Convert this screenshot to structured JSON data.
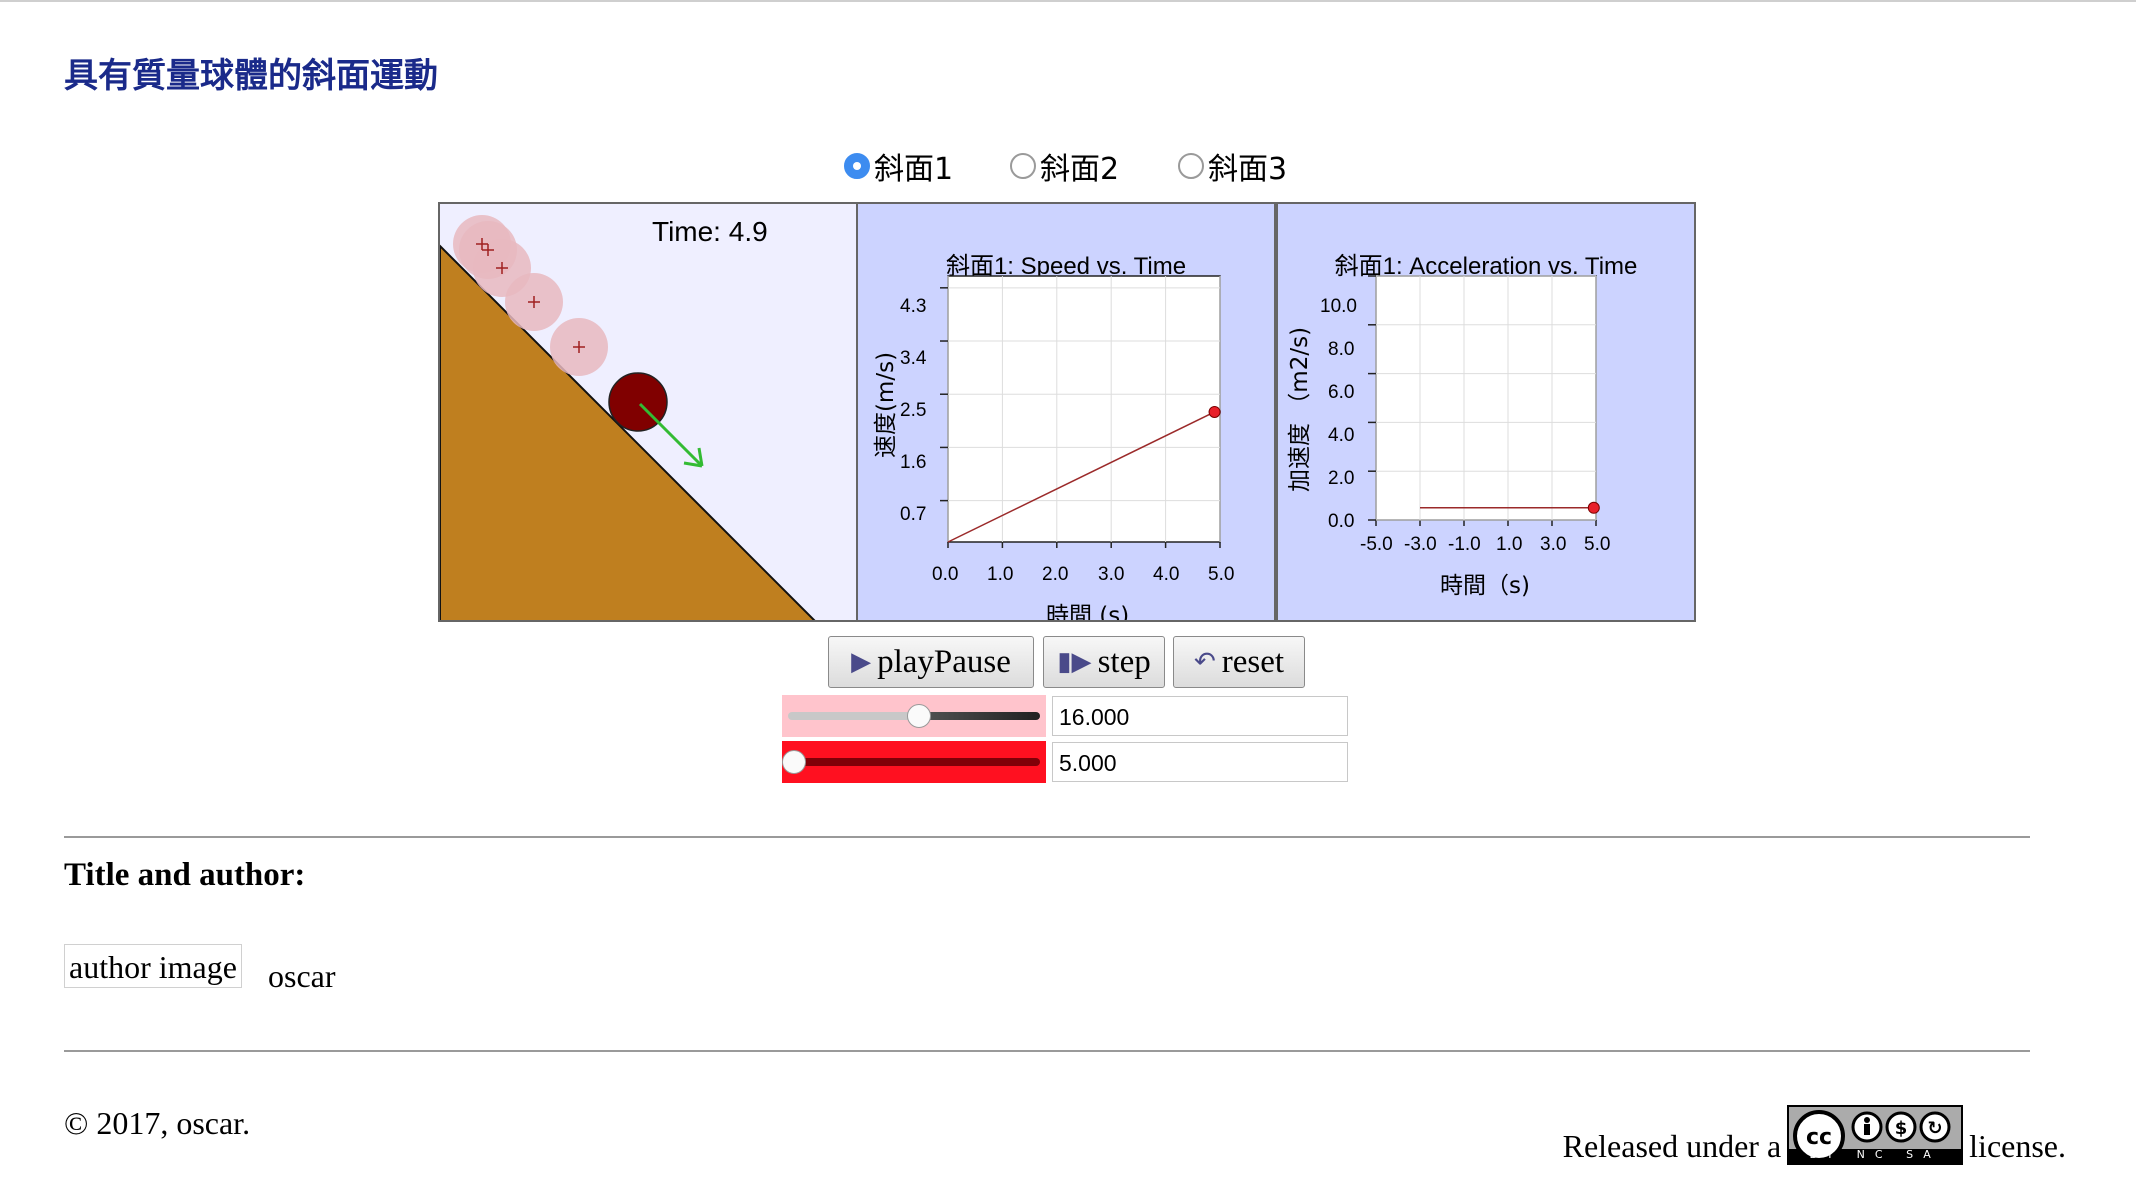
{
  "page": {
    "title": "具有質量球體的斜面運動"
  },
  "radios": [
    {
      "label": "斜面1",
      "checked": true
    },
    {
      "label": "斜面2",
      "checked": false
    },
    {
      "label": "斜面3",
      "checked": false
    }
  ],
  "simulation": {
    "time_label": "Time: 4.9",
    "ground_color": "#bf7f1f",
    "ball_color": "#800000",
    "arrow_color": "#33bb33"
  },
  "charts": {
    "speed": {
      "title": "斜面1: Speed vs. Time",
      "ylabel": "速度(m/s)",
      "xlabel": "時間 (s)",
      "yticks": [
        "4.3",
        "3.4",
        "2.5",
        "1.6",
        "0.7"
      ],
      "xticks": [
        "0.0",
        "1.0",
        "2.0",
        "3.0",
        "4.0",
        "5.0"
      ]
    },
    "accel": {
      "title": "斜面1: Acceleration vs. Time",
      "ylabel": "加速度 （m2/s)",
      "xlabel": "時間（s)",
      "yticks": [
        "10.0",
        "8.0",
        "6.0",
        "4.0",
        "2.0",
        "0.0"
      ],
      "xticks": [
        "-5.0",
        "-3.0",
        "-1.0",
        "1.0",
        "3.0",
        "5.0"
      ]
    }
  },
  "chart_data": [
    {
      "type": "line",
      "title": "斜面1: Speed vs. Time",
      "xlabel": "時間 (s)",
      "ylabel": "速度(m/s)",
      "xlim": [
        0,
        5
      ],
      "ylim": [
        0,
        4.5
      ],
      "grid": true,
      "series": [
        {
          "x": [
            0,
            4.9
          ],
          "y": [
            0,
            2.2
          ]
        }
      ],
      "current_point": {
        "x": 4.9,
        "y": 2.2
      }
    },
    {
      "type": "line",
      "title": "斜面1: Acceleration vs. Time",
      "xlabel": "時間（s)",
      "ylabel": "加速度 （m2/s)",
      "xlim": [
        -5,
        5
      ],
      "ylim": [
        0,
        10
      ],
      "grid": true,
      "series": [
        {
          "x": [
            -3,
            4.9
          ],
          "y": [
            0.5,
            0.5
          ]
        }
      ],
      "current_point": {
        "x": 4.9,
        "y": 0.5
      }
    }
  ],
  "controls": {
    "play_label": "playPause",
    "step_label": "step",
    "reset_label": "reset",
    "slider1_value": "16.000",
    "slider1_fraction": 0.52,
    "slider2_value": "5.000",
    "slider2_fraction": 0.0
  },
  "footer": {
    "section_title": "Title and author:",
    "author_image_alt": "author image",
    "author_name": "oscar",
    "copyright": "© 2017, oscar.",
    "license_prefix": "Released under a",
    "license_suffix": "license.",
    "badge_text": "BY NC SA"
  }
}
